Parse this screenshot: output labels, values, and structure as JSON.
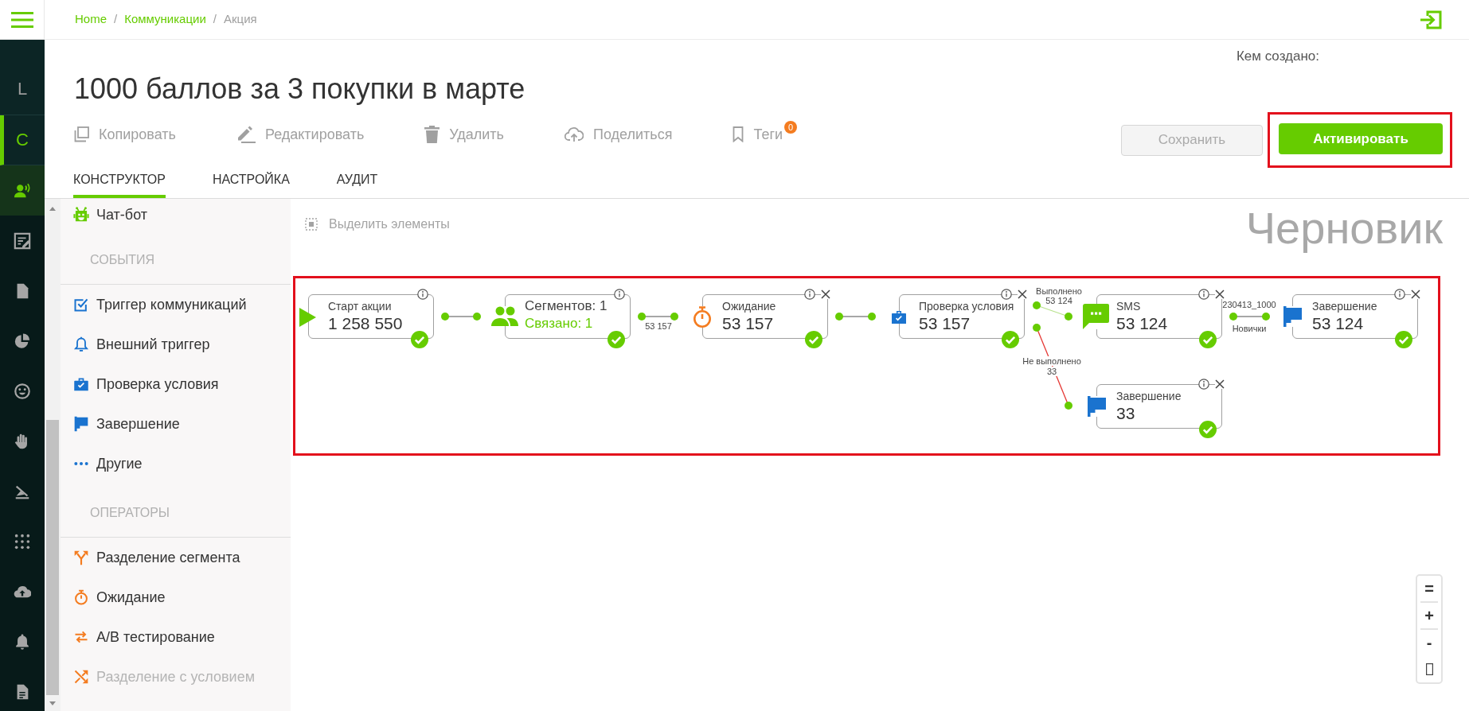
{
  "nav": {
    "letters": [
      {
        "label": "L",
        "selected": false
      },
      {
        "label": "C",
        "selected": true
      }
    ],
    "icons": [
      {
        "kind": "person-voice",
        "selected": true
      },
      {
        "kind": "edit",
        "selected": false
      },
      {
        "kind": "file",
        "selected": false
      },
      {
        "kind": "pie",
        "selected": false
      },
      {
        "kind": "smile",
        "selected": false
      },
      {
        "kind": "hand",
        "selected": false
      },
      {
        "kind": "slash",
        "selected": false
      },
      {
        "kind": "apps",
        "selected": false
      },
      {
        "kind": "upload",
        "selected": false
      },
      {
        "kind": "bell",
        "selected": false
      },
      {
        "kind": "doc",
        "selected": false
      }
    ]
  },
  "breadcrumb": [
    {
      "label": "Home",
      "current": false
    },
    {
      "separator": "/",
      "label": "Коммуникации",
      "current": false
    },
    {
      "separator": "/",
      "label": "Акция",
      "current": true
    }
  ],
  "created_by": {
    "label": "Кем создано:"
  },
  "title": "1000 баллов за 3 покупки в марте",
  "toolbar": [
    {
      "kind": "copy",
      "label": "Копировать"
    },
    {
      "kind": "edit",
      "label": "Редактировать"
    },
    {
      "kind": "delete",
      "label": "Удалить"
    },
    {
      "kind": "share",
      "label": "Поделиться"
    },
    {
      "kind": "tags",
      "label": "Теги",
      "badge": "0"
    }
  ],
  "buttons": [
    {
      "kind": "secondary",
      "label": "Сохранить",
      "disabled": true,
      "highlighted": false
    },
    {
      "kind": "primary",
      "label": "Активировать",
      "disabled": false,
      "highlighted": true
    }
  ],
  "tabs": [
    {
      "label": "КОНСТРУКТОР",
      "selected": true
    },
    {
      "label": "НАСТРОЙКА",
      "selected": false
    },
    {
      "label": "АУДИТ",
      "selected": false
    }
  ],
  "palette": {
    "sections": [
      {
        "items": [
          {
            "kind": "chatbot",
            "label": "Чат-бот",
            "disabled": false
          }
        ]
      },
      {
        "title": "СОБЫТИЯ",
        "items": [
          {
            "kind": "trigger",
            "label": "Триггер коммуникаций",
            "disabled": false
          },
          {
            "kind": "external-trigger",
            "label": "Внешний триггер",
            "disabled": false
          },
          {
            "kind": "condition",
            "label": "Проверка условия",
            "disabled": false
          },
          {
            "kind": "finish",
            "label": "Завершение",
            "disabled": false
          },
          {
            "kind": "others",
            "label": "Другие",
            "disabled": false
          }
        ]
      },
      {
        "title": "ОПЕРАТОРЫ",
        "items": [
          {
            "kind": "split",
            "label": "Разделение сегмента",
            "disabled": false
          },
          {
            "kind": "wait",
            "label": "Ожидание",
            "disabled": false
          },
          {
            "kind": "ab-test",
            "label": "А/В тестирование",
            "disabled": false
          },
          {
            "kind": "conditional-split",
            "label": "Разделение с условием",
            "disabled": true
          }
        ]
      }
    ]
  },
  "canvas": {
    "select_tool": {
      "label": "Выделить элементы",
      "disabled": true
    },
    "status": "Черновик",
    "highlighted": true,
    "nodes": [
      {
        "kind": "start",
        "title": "Старт акции",
        "value": "1 258 550",
        "done": true,
        "closable": false
      },
      {
        "kind": "segment",
        "title": "Сегментов: 1",
        "value": "Связано: 1",
        "done": true,
        "closable": false
      },
      {
        "kind": "wait",
        "title": "Ожидание",
        "value": "53 157",
        "done": true,
        "closable": true
      },
      {
        "kind": "condition",
        "title": "Проверка условия",
        "value": "53 157",
        "done": true,
        "closable": true
      },
      {
        "kind": "sms",
        "title": "SMS",
        "value": "53 124",
        "done": true,
        "closable": true
      },
      {
        "kind": "finish",
        "title": "Завершение",
        "value": "53 124",
        "done": true,
        "closable": true
      },
      {
        "kind": "finish",
        "title": "Завершение",
        "value": "33",
        "done": true,
        "closable": true
      }
    ],
    "links": [
      {
        "kind": "plain"
      },
      {
        "kind": "plain",
        "label": [
          "53 157"
        ]
      },
      {
        "kind": "plain"
      },
      {
        "kind": "yes",
        "label": [
          "Выполнено",
          "53 124"
        ]
      },
      {
        "kind": "no",
        "label": [
          "Не выполнено",
          "33"
        ]
      },
      {
        "kind": "plain",
        "label": [
          "230413_1000",
          "Новички"
        ]
      }
    ],
    "zoom_controls": [
      {
        "kind": "text",
        "label": "="
      },
      {
        "kind": "text",
        "label": "+"
      },
      {
        "kind": "text",
        "label": "-"
      },
      {
        "kind": "box"
      }
    ]
  }
}
